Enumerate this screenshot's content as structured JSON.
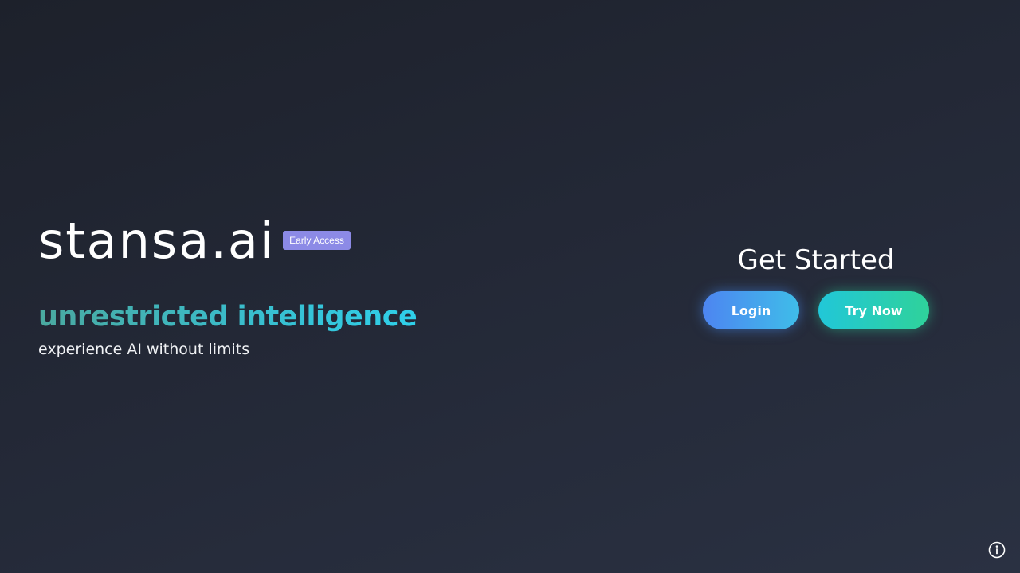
{
  "hero": {
    "brand": "stansa.ai",
    "badge": "Early Access",
    "tagline": "unrestricted intelligence",
    "subline": "experience AI without limits"
  },
  "cta": {
    "title": "Get Started",
    "login_label": "Login",
    "try_label": "Try Now"
  },
  "icons": {
    "info": "info-icon"
  },
  "colors": {
    "background_start": "#1d212b",
    "background_end": "#2a3142",
    "badge": "#8c8ae6",
    "login_gradient": [
      "#4d85f1",
      "#3fbde9"
    ],
    "try_gradient": [
      "#21c7d8",
      "#2fd29a"
    ],
    "tagline_gradient": [
      "#4aa9a0",
      "#2fd0ea"
    ]
  }
}
